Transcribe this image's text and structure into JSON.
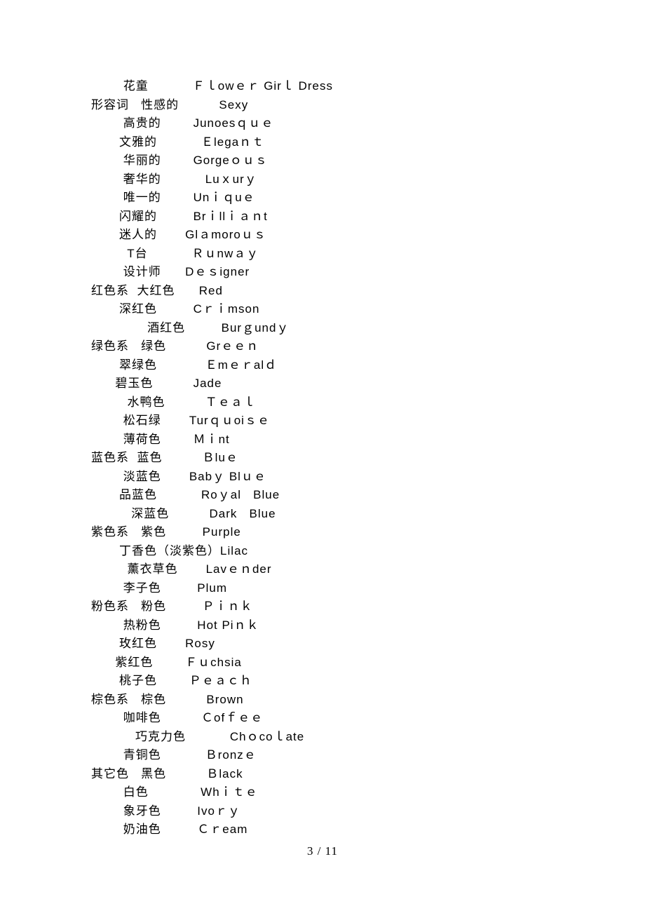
{
  "rows": [
    "        花童           Ｆｌowｅｒ Girｌ Dress",
    "形容词   性感的          Sexy",
    "        高贵的        Junoesｑｕｅ",
    "       文雅的           Ｅlegaｎｔ",
    "        华丽的        Gorgeｏｕｓ",
    "        奢华的           Luｘurｙ",
    "        唯一的        Unｉｑuｅ",
    "       闪耀的         Brｉllｉａｎt",
    "       迷人的       Glａmoroｕｓ",
    "         T台           Ｒｕnwａｙ",
    "        设计师      Dｅｓigner",
    "红色系  大红色      Red",
    "       深红色         Cｒｉmson",
    "              酒红色         Burｇundｙ",
    "绿色系   绿色          Grｅｅｎ",
    "       翠绿色            Ｅmｅｒalｄ",
    "      碧玉色          Jade",
    "         水鸭色          Ｔｅａｌ",
    "        松石绿       Turｑｕoiｓｅ",
    "        薄荷色        Ｍｉnt",
    "蓝色系  蓝色          Ｂluｅ",
    "        淡蓝色       Babｙ Blｕｅ",
    "       品蓝色           Roｙal   Blue",
    "          深蓝色          Dark   Blue",
    "紫色系   紫色         Purple",
    "       丁香色（淡紫色）Lilac",
    "         薰衣草色       Lavｅｎder",
    "        李子色         Plum",
    "粉色系   粉色         Ｐｉｎｋ",
    "        热粉色         Hot Piｎｋ",
    "       玫红色       Rosy",
    "      紫红色        Ｆｕchsia",
    "       桃子色        Ｐｅａｃｈ",
    "棕色系   棕色          Brown",
    "        咖啡色          Ｃofｆｅｅ",
    "           巧克力色           Chｏcoｌate",
    "        青铜色           Ｂronzｅ",
    "其它色   黑色          Ｂlack",
    "        白色             Whｉｔｅ",
    "        象牙色         Ivoｒｙ",
    "        奶油色         Ｃｒeam"
  ],
  "footer": "3 / 11"
}
